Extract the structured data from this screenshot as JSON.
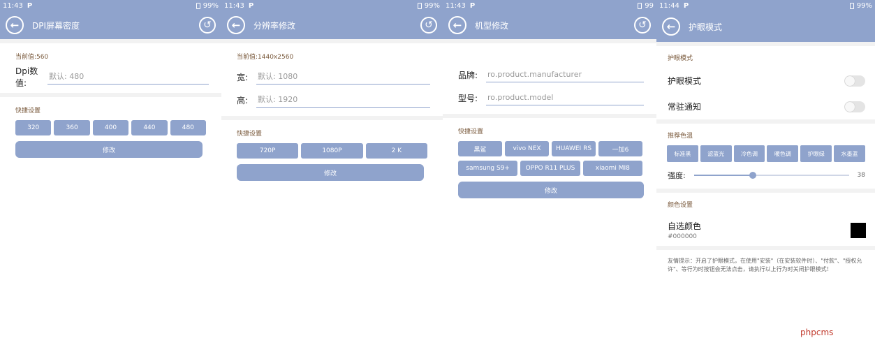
{
  "screens": [
    {
      "status": {
        "time": "11:43",
        "p": "P",
        "battery": "99%"
      },
      "title": "DPI屏幕密度",
      "current": "当前值:560",
      "fields": [
        {
          "label": "Dpi数值:",
          "placeholder": "默认: 480"
        }
      ],
      "quick_label": "快捷设置",
      "quick_buttons": [
        "320",
        "360",
        "400",
        "440",
        "480"
      ],
      "apply": "修改"
    },
    {
      "status": {
        "time": "11:43",
        "p": "P",
        "battery": "99%"
      },
      "title": "分辨率修改",
      "current": "当前值:1440x2560",
      "fields": [
        {
          "label": "宽:",
          "placeholder": "默认: 1080"
        },
        {
          "label": "高:",
          "placeholder": "默认: 1920"
        }
      ],
      "quick_label": "快捷设置",
      "quick_buttons": [
        "720P",
        "1080P",
        "2 K"
      ],
      "apply": "修改"
    },
    {
      "status": {
        "time": "11:43",
        "p": "P",
        "battery": "99"
      },
      "title": "机型修改",
      "fields": [
        {
          "label": "品牌:",
          "placeholder": "ro.product.manufacturer"
        },
        {
          "label": "型号:",
          "placeholder": "ro.product.model"
        }
      ],
      "quick_label": "快捷设置",
      "quick_buttons_row1": [
        "黑鲨",
        "vivo NEX",
        "HUAWEI RS",
        "一加6"
      ],
      "quick_buttons_row2": [
        "samsung S9+",
        "OPPO R11 PLUS",
        "xiaomi MI8"
      ],
      "apply": "修改"
    },
    {
      "status": {
        "time": "11:44",
        "p": "P",
        "battery": "99%"
      },
      "title": "护眼模式",
      "section1": "护眼模式",
      "toggles": [
        {
          "label": "护眼模式",
          "on": false
        },
        {
          "label": "常驻通知",
          "on": false
        }
      ],
      "section2": "推荐色温",
      "presets": [
        "标准黑",
        "滤蓝光",
        "冷色调",
        "暖色调",
        "护眼绿",
        "水墨蓝"
      ],
      "strength_label": "强度:",
      "strength_value": "38",
      "strength_fraction": 0.38,
      "section3": "颜色设置",
      "color_label": "自选颜色",
      "color_value": "#000000",
      "hint": "友情提示：开启了护眼模式，在使用\"安装\"（在安装软件时）、\"付款\"、\"授权允许\"、等行为时按钮会无法点击，请执行以上行为时关闭护眼模式！"
    }
  ],
  "theme": {
    "accent": "#8fa3cc"
  },
  "watermark": "phpcms"
}
